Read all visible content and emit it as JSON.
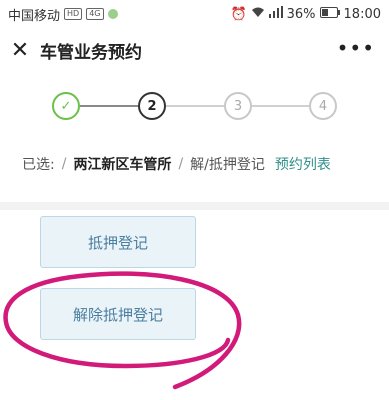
{
  "status_bar": {
    "carrier": "中国移动",
    "hd_badge": "HD",
    "signal_badge": "4G",
    "battery": "36%",
    "time": "18:00"
  },
  "title_bar": {
    "close_label": "✕",
    "title": "车管业务预约",
    "more_label": "•••"
  },
  "steps": [
    {
      "label": "✓",
      "state": "done"
    },
    {
      "label": "2",
      "state": "active"
    },
    {
      "label": "3",
      "state": "todo"
    },
    {
      "label": "4",
      "state": "todo"
    }
  ],
  "breadcrumb": {
    "prefix": "已选:",
    "separator": "/",
    "office": "两江新区车管所",
    "service": "解/抵押登记",
    "link": "预约列表"
  },
  "options": [
    {
      "label": "抵押登记"
    },
    {
      "label": "解除抵押登记"
    }
  ],
  "colors": {
    "accent": "#2f8f8a",
    "done": "#6cc04a",
    "button_bg": "#eaf3f8",
    "button_text": "#4a7fa0",
    "annotation": "#d11a7a"
  }
}
